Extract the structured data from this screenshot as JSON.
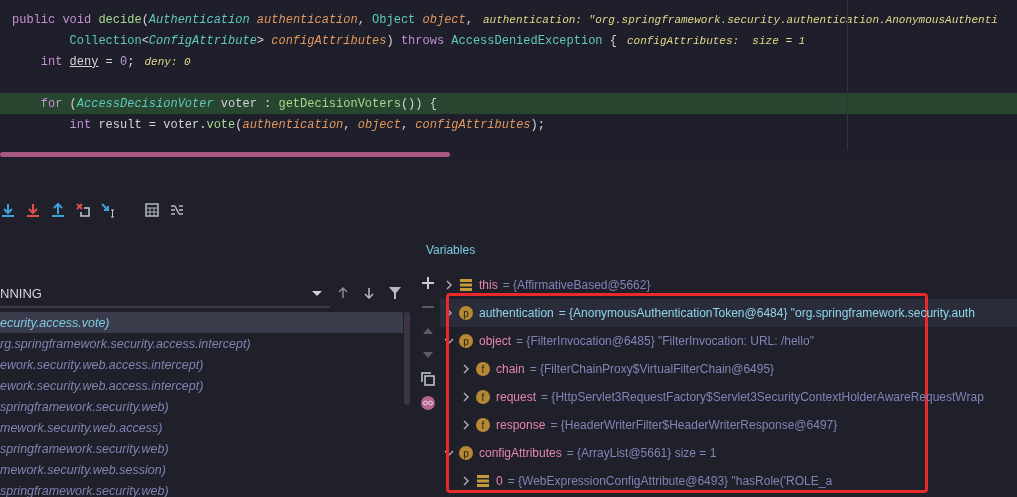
{
  "editor": {
    "lines": [
      {
        "current": false,
        "tokens": [
          {
            "kind": "kw",
            "text": "public void "
          },
          {
            "kind": "method",
            "text": "decide"
          },
          {
            "kind": "plain",
            "text": "("
          },
          {
            "kind": "itype",
            "text": "Authentication"
          },
          {
            "kind": "param",
            "text": " authentication"
          },
          {
            "kind": "plain",
            "text": ", "
          },
          {
            "kind": "type",
            "text": "Object"
          },
          {
            "kind": "param",
            "text": " object"
          },
          {
            "kind": "plain",
            "text": ","
          }
        ],
        "hint": "authentication: \"org.springframework.security.authentication.AnonymousAuthenti"
      },
      {
        "current": false,
        "tokens": [
          {
            "kind": "type",
            "text": "        Collection"
          },
          {
            "kind": "plain",
            "text": "<"
          },
          {
            "kind": "itype",
            "text": "ConfigAttribute"
          },
          {
            "kind": "plain",
            "text": "> "
          },
          {
            "kind": "param",
            "text": "configAttributes"
          },
          {
            "kind": "plain",
            "text": ") "
          },
          {
            "kind": "kw",
            "text": "throws "
          },
          {
            "kind": "type",
            "text": "AccessDeniedException"
          },
          {
            "kind": "plain",
            "text": " {"
          }
        ],
        "hint": "configAttributes:  size = 1"
      },
      {
        "current": false,
        "tokens": [
          {
            "kind": "kw",
            "text": "    int "
          },
          {
            "kind": "local",
            "text": "deny"
          },
          {
            "kind": "plain",
            "text": " = "
          },
          {
            "kind": "num",
            "text": "0"
          },
          {
            "kind": "plain",
            "text": ";"
          }
        ],
        "hint": "deny: 0"
      },
      {
        "current": false
      },
      {
        "current": true,
        "tokens": [
          {
            "kind": "kw",
            "text": "    for "
          },
          {
            "kind": "plain",
            "text": "("
          },
          {
            "kind": "itype",
            "text": "AccessDecisionVoter"
          },
          {
            "kind": "plain",
            "text": " voter : "
          },
          {
            "kind": "method",
            "text": "getDecisionVoters"
          },
          {
            "kind": "plain",
            "text": "()) {"
          }
        ]
      },
      {
        "current": false,
        "tokens": [
          {
            "kind": "kw",
            "text": "        int "
          },
          {
            "kind": "plain",
            "text": "result = voter."
          },
          {
            "kind": "method",
            "text": "vote"
          },
          {
            "kind": "plain",
            "text": "("
          },
          {
            "kind": "param",
            "text": "authentication"
          },
          {
            "kind": "plain",
            "text": ", "
          },
          {
            "kind": "param",
            "text": "object"
          },
          {
            "kind": "plain",
            "text": ", "
          },
          {
            "kind": "param",
            "text": "configAttributes"
          },
          {
            "kind": "plain",
            "text": ");"
          }
        ]
      },
      {
        "current": false
      }
    ]
  },
  "frames": {
    "header": "NNING",
    "items": [
      {
        "text": "ecurity.access.vote)",
        "selected": true
      },
      {
        "text": "rg.springframework.security.access.intercept)",
        "selected": false
      },
      {
        "text": "ework.security.web.access.intercept)",
        "selected": false
      },
      {
        "text": "ework.security.web.access.intercept)",
        "selected": false
      },
      {
        "text": "springframework.security.web)",
        "selected": false
      },
      {
        "text": "mework.security.web.access)",
        "selected": false
      },
      {
        "text": "springframework.security.web)",
        "selected": false
      },
      {
        "text": "mework.security.web.session)",
        "selected": false
      },
      {
        "text": "springframework.security.web)",
        "selected": false
      }
    ]
  },
  "variables": {
    "title": "Variables",
    "items": [
      {
        "kind": "object",
        "name": "this",
        "value": "= {AffirmativeBased@5662}",
        "expanded": false,
        "selected": false
      },
      {
        "kind": "param",
        "badge": "p",
        "name": "authentication",
        "value": "= {AnonymousAuthenticationToken@6484} \"org.springframework.security.auth",
        "expanded": false,
        "selected": true
      },
      {
        "kind": "param",
        "badge": "p",
        "name": "object",
        "value": "= {FilterInvocation@6485} \"FilterInvocation: URL: /hello\"",
        "expanded": true,
        "selected": false,
        "children": [
          {
            "kind": "field",
            "badge": "f",
            "name": "chain",
            "value": "= {FilterChainProxy$VirtualFilterChain@6495}",
            "expanded": false,
            "selected": false
          },
          {
            "kind": "field",
            "badge": "f",
            "name": "request",
            "value": "= {HttpServlet3RequestFactory$Servlet3SecurityContextHolderAwareRequestWrap",
            "expanded": false,
            "selected": false
          },
          {
            "kind": "field",
            "badge": "f",
            "name": "response",
            "value": "= {HeaderWriterFilter$HeaderWriterResponse@6497}",
            "expanded": false,
            "selected": false
          }
        ]
      },
      {
        "kind": "param",
        "badge": "p",
        "name": "configAttributes",
        "value": "= {ArrayList@5661}  size = 1",
        "expanded": true,
        "selected": false,
        "children": [
          {
            "kind": "object",
            "name": "0",
            "value": "= {WebExpressionConfigAttribute@6493} \"hasRole('ROLE_a",
            "expanded": false,
            "selected": false
          }
        ]
      }
    ]
  }
}
